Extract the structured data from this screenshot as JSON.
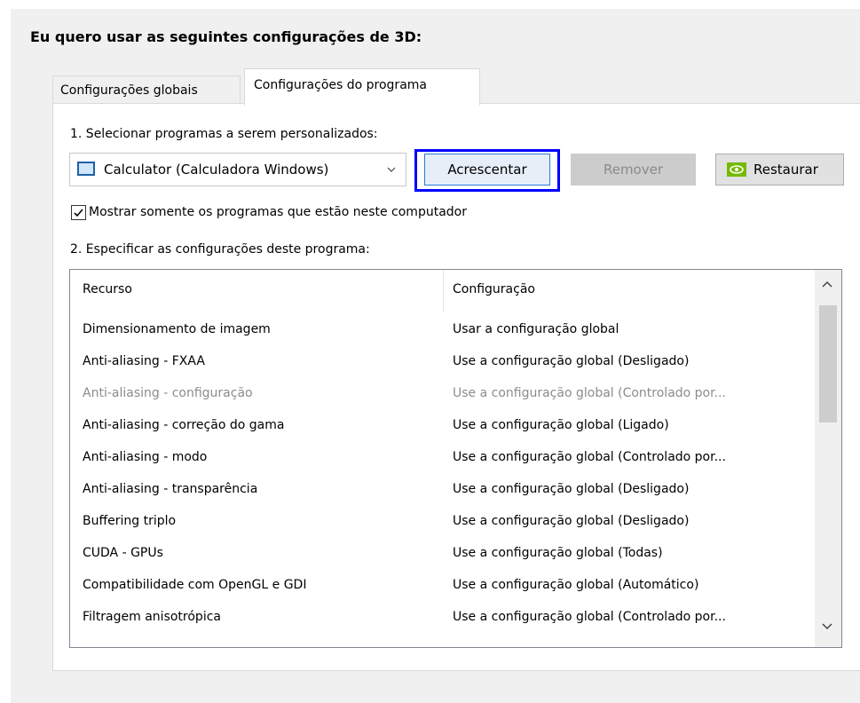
{
  "heading": "Eu quero usar as seguintes configurações de 3D:",
  "tabs": [
    {
      "label": "Configurações globais",
      "active": false
    },
    {
      "label": "Configurações do programa",
      "active": true
    }
  ],
  "select_label": "1. Selecionar programas a serem personalizados:",
  "program_select": {
    "value": "Calculator (Calculadora Windows)",
    "icon": "app-window-icon"
  },
  "buttons": {
    "add": "Acrescentar",
    "remove": "Remover",
    "restore": "Restaurar"
  },
  "checkbox": {
    "label": "Mostrar somente os programas que estão neste computador",
    "checked": true
  },
  "specify_label": "2. Especificar as configurações deste programa:",
  "settings_table": {
    "columns": [
      "Recurso",
      "Configuração"
    ],
    "rows": [
      {
        "feature": "Dimensionamento de imagem",
        "setting": "Usar a configuração global"
      },
      {
        "feature": "Anti-aliasing - FXAA",
        "setting": "Use a configuração global (Desligado)"
      },
      {
        "feature": "Anti-aliasing - configuração",
        "setting": "Use a configuração global (Controlado por...",
        "disabled": true
      },
      {
        "feature": "Anti-aliasing - correção do gama",
        "setting": "Use a configuração global (Ligado)"
      },
      {
        "feature": "Anti-aliasing - modo",
        "setting": "Use a configuração global (Controlado por..."
      },
      {
        "feature": "Anti-aliasing - transparência",
        "setting": "Use a configuração global (Desligado)"
      },
      {
        "feature": "Buffering triplo",
        "setting": "Use a configuração global (Desligado)"
      },
      {
        "feature": "CUDA - GPUs",
        "setting": "Use a configuração global (Todas)"
      },
      {
        "feature": "Compatibilidade com OpenGL e GDI",
        "setting": "Use a configuração global (Automático)"
      },
      {
        "feature": "Filtragem anisotrópica",
        "setting": "Use a configuração global (Controlado por..."
      }
    ]
  },
  "colors": {
    "focus_border": "#0000ff",
    "accent": "#2b7bd6",
    "nvidia_green": "#76b900"
  }
}
